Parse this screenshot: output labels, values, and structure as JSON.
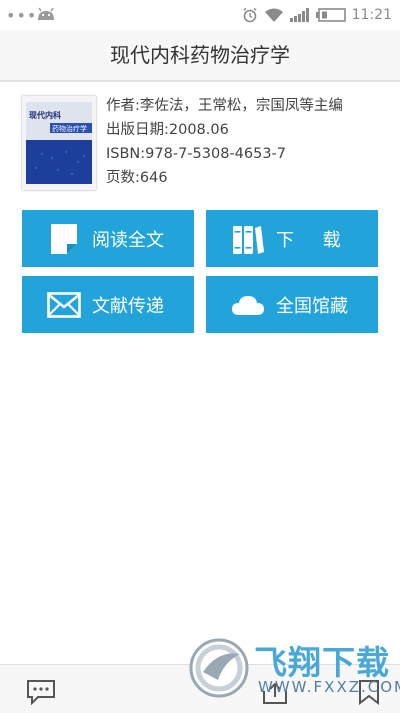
{
  "status_bar": {
    "time": "11:21",
    "icons": [
      "more-dots-icon",
      "android-icon",
      "alarm-icon",
      "wifi-icon",
      "signal-icon",
      "battery-icon"
    ]
  },
  "header": {
    "title": "现代内科药物治疗学"
  },
  "book": {
    "cover_title_line1": "现代内科",
    "cover_title_line2": "药物治疗学",
    "author": "作者:李佐法，王常松，宗国凤等主编",
    "publish_date": "出版日期:2008.06",
    "isbn": "ISBN:978-7-5308-4653-7",
    "pages": "页数:646"
  },
  "actions": [
    {
      "label": "阅读全文",
      "icon": "document-icon"
    },
    {
      "label": "下     载",
      "icon": "books-icon"
    },
    {
      "label": "文献传递",
      "icon": "envelope-icon"
    },
    {
      "label": "全国馆藏",
      "icon": "cloud-icon"
    }
  ],
  "bottom_bar": {
    "icons": [
      "comment-icon",
      "share-icon",
      "bookmark-icon"
    ]
  },
  "watermark": {
    "text": "飞翔下载",
    "url": "WWW.FXXZ.COM"
  },
  "colors": {
    "accent": "#22a3da",
    "title_bar": "#f7f7f7",
    "text": "#444444"
  }
}
